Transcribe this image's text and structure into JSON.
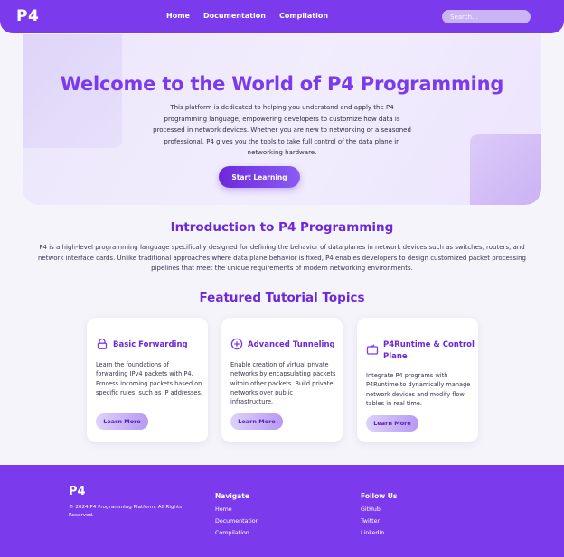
{
  "nav": {
    "brand": "P4",
    "links": [
      "Home",
      "Documentation",
      "Compilation"
    ],
    "search_placeholder": "Search..."
  },
  "hero": {
    "title": "Welcome to the World of P4 Programming",
    "text": "This platform is dedicated to helping you understand and apply the P4 programming language, empowering developers to customize how data is processed in network devices. Whether you are new to networking or a seasoned professional, P4 gives you the tools to take full control of the data plane in networking hardware.",
    "cta": "Start Learning"
  },
  "intro": {
    "title": "Introduction to P4 Programming",
    "text": "P4 is a high-level programming language specifically designed for defining the behavior of data planes in network devices such as switches, routers, and network interface cards. Unlike traditional approaches where data plane behavior is fixed, P4 enables developers to design customized packet processing pipelines that meet the unique requirements of modern networking environments."
  },
  "featured": {
    "title": "Featured Tutorial Topics",
    "cards": [
      {
        "icon": "lock-icon",
        "title": "Basic Forwarding",
        "text": "Learn the foundations of forwarding IPv4 packets with P4. Process incoming packets based on specific rules, such as IP addresses.",
        "button": "Learn More"
      },
      {
        "icon": "plus-circle-icon",
        "title": "Advanced Tunneling",
        "text": "Enable creation of virtual private networks by encapsulating packets within other packets. Build private networks over public infrastructure.",
        "button": "Learn More"
      },
      {
        "icon": "tv-icon",
        "title": "P4Runtime & Control Plane",
        "text": "Integrate P4 programs with P4Runtime to dynamically manage network devices and modify flow tables in real time.",
        "button": "Learn More"
      }
    ]
  },
  "footer": {
    "brand": "P4",
    "copyright": "© 2024 P4 Programming Platform. All Rights Reserved.",
    "navigate": {
      "title": "Navigate",
      "links": [
        "Home",
        "Documentation",
        "Compilation"
      ]
    },
    "follow": {
      "title": "Follow Us",
      "links": [
        "GitHub",
        "Twitter",
        "LinkedIn"
      ]
    }
  },
  "colors": {
    "accent": "#7c3aed",
    "accent_dark": "#6d28d9",
    "background": "#f5f4fa"
  }
}
